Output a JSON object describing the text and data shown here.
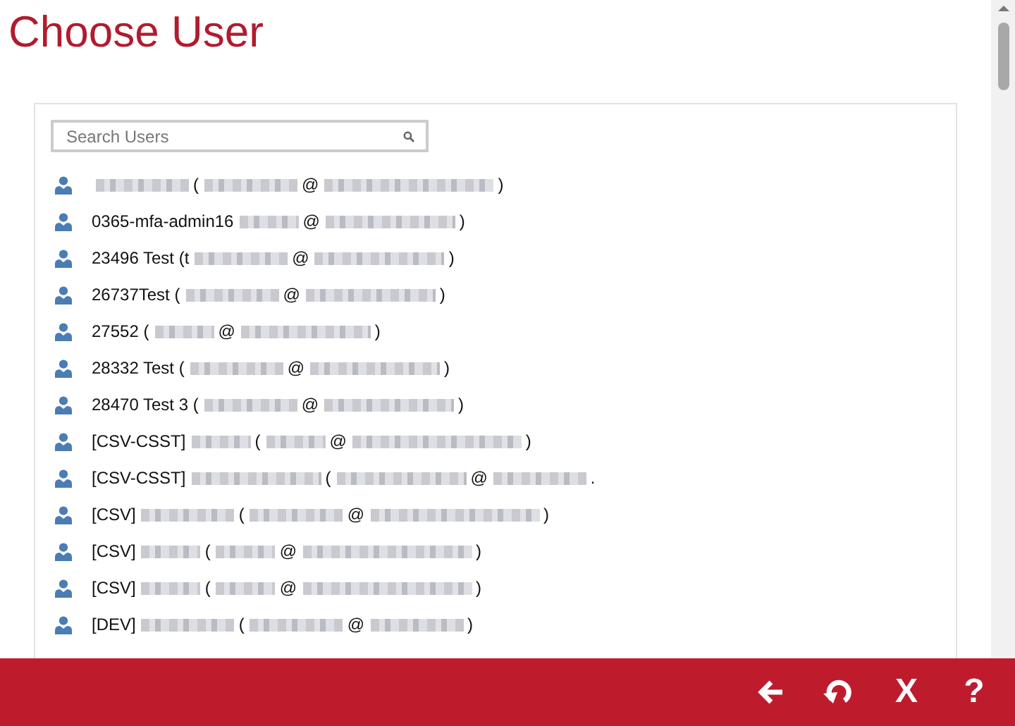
{
  "title": "Choose User",
  "search": {
    "placeholder": "Search Users"
  },
  "users": [
    {
      "parts": [
        {
          "kind": "blur-m"
        },
        {
          "kind": "text",
          "text": "("
        },
        {
          "kind": "blur-m"
        },
        {
          "kind": "text",
          "text": "@"
        },
        {
          "kind": "blur-xl"
        },
        {
          "kind": "text",
          "text": ")"
        }
      ]
    },
    {
      "parts": [
        {
          "kind": "text",
          "text": "0365-mfa-admin16"
        },
        {
          "kind": "blur-s"
        },
        {
          "kind": "text",
          "text": "@"
        },
        {
          "kind": "blur-l"
        },
        {
          "kind": "text",
          "text": ")"
        }
      ]
    },
    {
      "parts": [
        {
          "kind": "text",
          "text": "23496 Test (t"
        },
        {
          "kind": "blur-m"
        },
        {
          "kind": "text",
          "text": "@"
        },
        {
          "kind": "blur-l"
        },
        {
          "kind": "text",
          "text": ")"
        }
      ]
    },
    {
      "parts": [
        {
          "kind": "text",
          "text": "26737Test ("
        },
        {
          "kind": "blur-m"
        },
        {
          "kind": "text",
          "text": "@"
        },
        {
          "kind": "blur-l"
        },
        {
          "kind": "text",
          "text": ")"
        }
      ]
    },
    {
      "parts": [
        {
          "kind": "text",
          "text": "27552 ("
        },
        {
          "kind": "blur-s"
        },
        {
          "kind": "text",
          "text": "@"
        },
        {
          "kind": "blur-l"
        },
        {
          "kind": "text",
          "text": ")"
        }
      ]
    },
    {
      "parts": [
        {
          "kind": "text",
          "text": "28332 Test ("
        },
        {
          "kind": "blur-m"
        },
        {
          "kind": "text",
          "text": "@"
        },
        {
          "kind": "blur-l"
        },
        {
          "kind": "text",
          "text": ")"
        }
      ]
    },
    {
      "parts": [
        {
          "kind": "text",
          "text": "28470 Test 3 ("
        },
        {
          "kind": "blur-m"
        },
        {
          "kind": "text",
          "text": "@"
        },
        {
          "kind": "blur-l"
        },
        {
          "kind": "text",
          "text": ")"
        }
      ]
    },
    {
      "parts": [
        {
          "kind": "text",
          "text": "[CSV-CSST]"
        },
        {
          "kind": "blur-s"
        },
        {
          "kind": "text",
          "text": "("
        },
        {
          "kind": "blur-s"
        },
        {
          "kind": "text",
          "text": "@"
        },
        {
          "kind": "blur-xl"
        },
        {
          "kind": "text",
          "text": ")"
        }
      ]
    },
    {
      "parts": [
        {
          "kind": "text",
          "text": "[CSV-CSST]"
        },
        {
          "kind": "blur-l"
        },
        {
          "kind": "text",
          "text": "("
        },
        {
          "kind": "blur-l"
        },
        {
          "kind": "text",
          "text": "@"
        },
        {
          "kind": "blur-m"
        },
        {
          "kind": "text",
          "text": "."
        }
      ]
    },
    {
      "parts": [
        {
          "kind": "text",
          "text": "[CSV]"
        },
        {
          "kind": "blur-m"
        },
        {
          "kind": "text",
          "text": "("
        },
        {
          "kind": "blur-m"
        },
        {
          "kind": "text",
          "text": "@"
        },
        {
          "kind": "blur-xl"
        },
        {
          "kind": "text",
          "text": ")"
        }
      ]
    },
    {
      "parts": [
        {
          "kind": "text",
          "text": "[CSV]"
        },
        {
          "kind": "blur-s"
        },
        {
          "kind": "text",
          "text": "("
        },
        {
          "kind": "blur-s"
        },
        {
          "kind": "text",
          "text": "@"
        },
        {
          "kind": "blur-xl"
        },
        {
          "kind": "text",
          "text": ")"
        }
      ]
    },
    {
      "parts": [
        {
          "kind": "text",
          "text": "[CSV]"
        },
        {
          "kind": "blur-s"
        },
        {
          "kind": "text",
          "text": "("
        },
        {
          "kind": "blur-s"
        },
        {
          "kind": "text",
          "text": "@"
        },
        {
          "kind": "blur-xl"
        },
        {
          "kind": "text",
          "text": ")"
        }
      ]
    },
    {
      "parts": [
        {
          "kind": "text",
          "text": "[DEV]"
        },
        {
          "kind": "blur-m"
        },
        {
          "kind": "text",
          "text": "("
        },
        {
          "kind": "blur-m"
        },
        {
          "kind": "text",
          "text": "@"
        },
        {
          "kind": "blur-m"
        },
        {
          "kind": "text",
          "text": ")"
        }
      ]
    }
  ],
  "footer": [
    {
      "kind": "back"
    },
    {
      "kind": "undo"
    },
    {
      "kind": "glyph",
      "text": "X"
    },
    {
      "kind": "glyph",
      "text": "?"
    }
  ]
}
